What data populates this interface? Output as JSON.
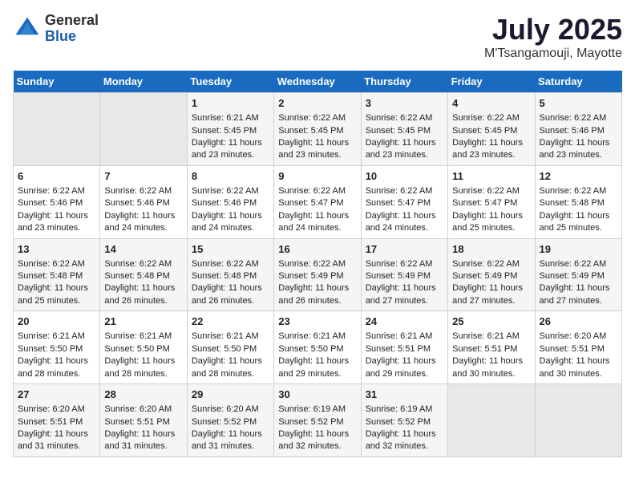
{
  "logo": {
    "general": "General",
    "blue": "Blue"
  },
  "title": "July 2025",
  "subtitle": "M'Tsangamouji, Mayotte",
  "days_of_week": [
    "Sunday",
    "Monday",
    "Tuesday",
    "Wednesday",
    "Thursday",
    "Friday",
    "Saturday"
  ],
  "weeks": [
    [
      {
        "day": "",
        "content": ""
      },
      {
        "day": "",
        "content": ""
      },
      {
        "day": "1",
        "content": "Sunrise: 6:21 AM\nSunset: 5:45 PM\nDaylight: 11 hours and 23 minutes."
      },
      {
        "day": "2",
        "content": "Sunrise: 6:22 AM\nSunset: 5:45 PM\nDaylight: 11 hours and 23 minutes."
      },
      {
        "day": "3",
        "content": "Sunrise: 6:22 AM\nSunset: 5:45 PM\nDaylight: 11 hours and 23 minutes."
      },
      {
        "day": "4",
        "content": "Sunrise: 6:22 AM\nSunset: 5:45 PM\nDaylight: 11 hours and 23 minutes."
      },
      {
        "day": "5",
        "content": "Sunrise: 6:22 AM\nSunset: 5:46 PM\nDaylight: 11 hours and 23 minutes."
      }
    ],
    [
      {
        "day": "6",
        "content": "Sunrise: 6:22 AM\nSunset: 5:46 PM\nDaylight: 11 hours and 23 minutes."
      },
      {
        "day": "7",
        "content": "Sunrise: 6:22 AM\nSunset: 5:46 PM\nDaylight: 11 hours and 24 minutes."
      },
      {
        "day": "8",
        "content": "Sunrise: 6:22 AM\nSunset: 5:46 PM\nDaylight: 11 hours and 24 minutes."
      },
      {
        "day": "9",
        "content": "Sunrise: 6:22 AM\nSunset: 5:47 PM\nDaylight: 11 hours and 24 minutes."
      },
      {
        "day": "10",
        "content": "Sunrise: 6:22 AM\nSunset: 5:47 PM\nDaylight: 11 hours and 24 minutes."
      },
      {
        "day": "11",
        "content": "Sunrise: 6:22 AM\nSunset: 5:47 PM\nDaylight: 11 hours and 25 minutes."
      },
      {
        "day": "12",
        "content": "Sunrise: 6:22 AM\nSunset: 5:48 PM\nDaylight: 11 hours and 25 minutes."
      }
    ],
    [
      {
        "day": "13",
        "content": "Sunrise: 6:22 AM\nSunset: 5:48 PM\nDaylight: 11 hours and 25 minutes."
      },
      {
        "day": "14",
        "content": "Sunrise: 6:22 AM\nSunset: 5:48 PM\nDaylight: 11 hours and 26 minutes."
      },
      {
        "day": "15",
        "content": "Sunrise: 6:22 AM\nSunset: 5:48 PM\nDaylight: 11 hours and 26 minutes."
      },
      {
        "day": "16",
        "content": "Sunrise: 6:22 AM\nSunset: 5:49 PM\nDaylight: 11 hours and 26 minutes."
      },
      {
        "day": "17",
        "content": "Sunrise: 6:22 AM\nSunset: 5:49 PM\nDaylight: 11 hours and 27 minutes."
      },
      {
        "day": "18",
        "content": "Sunrise: 6:22 AM\nSunset: 5:49 PM\nDaylight: 11 hours and 27 minutes."
      },
      {
        "day": "19",
        "content": "Sunrise: 6:22 AM\nSunset: 5:49 PM\nDaylight: 11 hours and 27 minutes."
      }
    ],
    [
      {
        "day": "20",
        "content": "Sunrise: 6:21 AM\nSunset: 5:50 PM\nDaylight: 11 hours and 28 minutes."
      },
      {
        "day": "21",
        "content": "Sunrise: 6:21 AM\nSunset: 5:50 PM\nDaylight: 11 hours and 28 minutes."
      },
      {
        "day": "22",
        "content": "Sunrise: 6:21 AM\nSunset: 5:50 PM\nDaylight: 11 hours and 28 minutes."
      },
      {
        "day": "23",
        "content": "Sunrise: 6:21 AM\nSunset: 5:50 PM\nDaylight: 11 hours and 29 minutes."
      },
      {
        "day": "24",
        "content": "Sunrise: 6:21 AM\nSunset: 5:51 PM\nDaylight: 11 hours and 29 minutes."
      },
      {
        "day": "25",
        "content": "Sunrise: 6:21 AM\nSunset: 5:51 PM\nDaylight: 11 hours and 30 minutes."
      },
      {
        "day": "26",
        "content": "Sunrise: 6:20 AM\nSunset: 5:51 PM\nDaylight: 11 hours and 30 minutes."
      }
    ],
    [
      {
        "day": "27",
        "content": "Sunrise: 6:20 AM\nSunset: 5:51 PM\nDaylight: 11 hours and 31 minutes."
      },
      {
        "day": "28",
        "content": "Sunrise: 6:20 AM\nSunset: 5:51 PM\nDaylight: 11 hours and 31 minutes."
      },
      {
        "day": "29",
        "content": "Sunrise: 6:20 AM\nSunset: 5:52 PM\nDaylight: 11 hours and 31 minutes."
      },
      {
        "day": "30",
        "content": "Sunrise: 6:19 AM\nSunset: 5:52 PM\nDaylight: 11 hours and 32 minutes."
      },
      {
        "day": "31",
        "content": "Sunrise: 6:19 AM\nSunset: 5:52 PM\nDaylight: 11 hours and 32 minutes."
      },
      {
        "day": "",
        "content": ""
      },
      {
        "day": "",
        "content": ""
      }
    ]
  ]
}
